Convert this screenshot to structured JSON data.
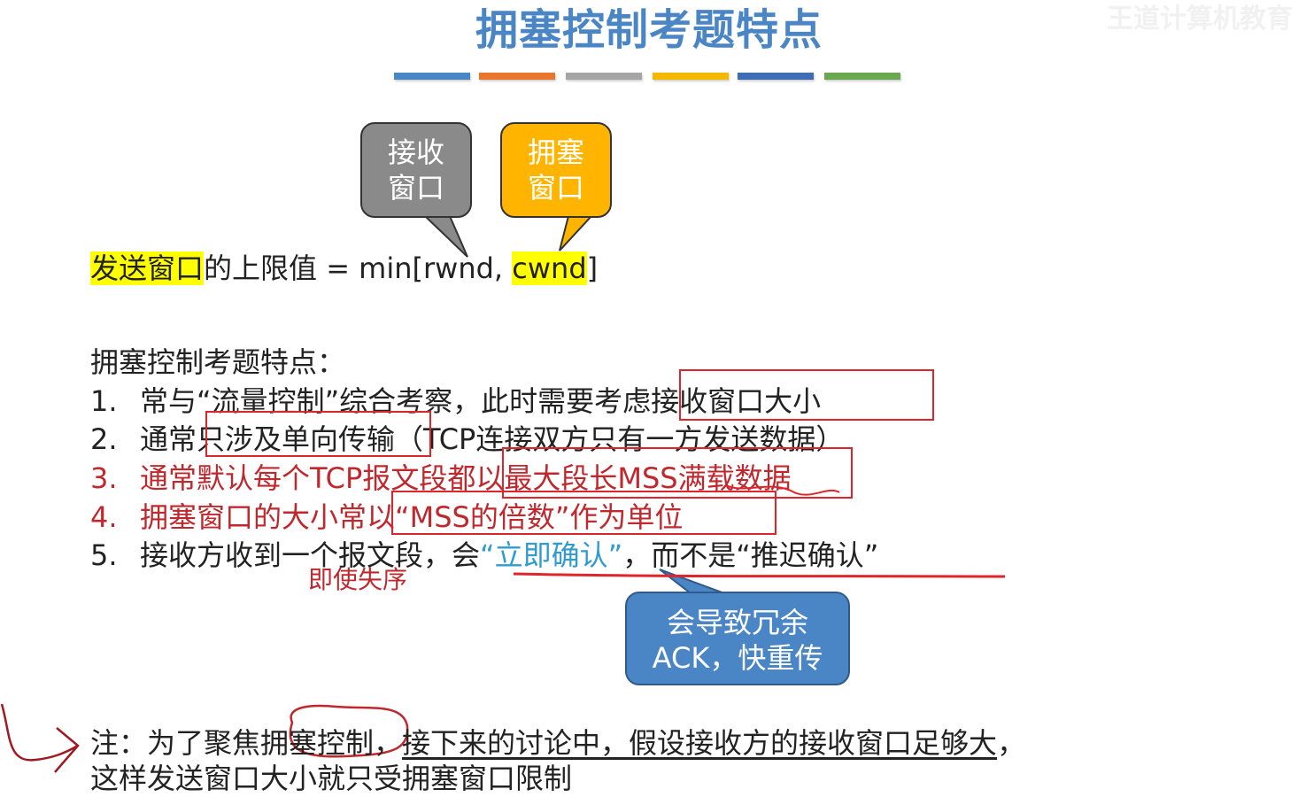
{
  "header": {
    "title": "拥塞控制考题特点",
    "watermark": "王道计算机教育",
    "bar_colors": [
      "#4a86c5",
      "#e9762b",
      "#a5a5a5",
      "#f5b800",
      "#3e6db5",
      "#6aa84f"
    ]
  },
  "callouts": {
    "receive_window": "接收\n窗口",
    "congestion_window": "拥塞\n窗口",
    "ack_note": "会导致冗余\nACK，快重传"
  },
  "formula": {
    "highlight": "发送窗口",
    "text": "的上限值 = min[rwnd, ",
    "cwnd": "cwnd",
    "close": "]"
  },
  "section": {
    "heading": "拥塞控制考题特点：",
    "items": [
      {
        "num": "1.",
        "a": "常与“流量控制”综合考察，此时需要",
        "b": "考虑接收窗口大小"
      },
      {
        "num": "2.",
        "a": "通常",
        "b": "只涉及单向传输",
        "c": "（TCP连接双方只有一方发送数据）"
      },
      {
        "num": "3.",
        "a": "通常默认每个TCP报文段都",
        "b": "以最大段长MSS满载数据"
      },
      {
        "num": "4.",
        "a": "拥塞窗口的大小常",
        "b": "以“MSS的倍数”作为单位"
      },
      {
        "num": "5.",
        "a": "接收方收到一个报文段，会",
        "b": "“立即确认”",
        "c": "，而不是“推迟确认”"
      }
    ],
    "annotation": "即使失序"
  },
  "note": {
    "prefix": "注：为了聚焦",
    "focus": "拥塞控制",
    "comma": "，",
    "underlined": "接下来的讨论中，假设接收方的接收窗口足够大",
    "end": "，",
    "line2": "这样发送窗口大小就只受拥塞窗口限制"
  }
}
